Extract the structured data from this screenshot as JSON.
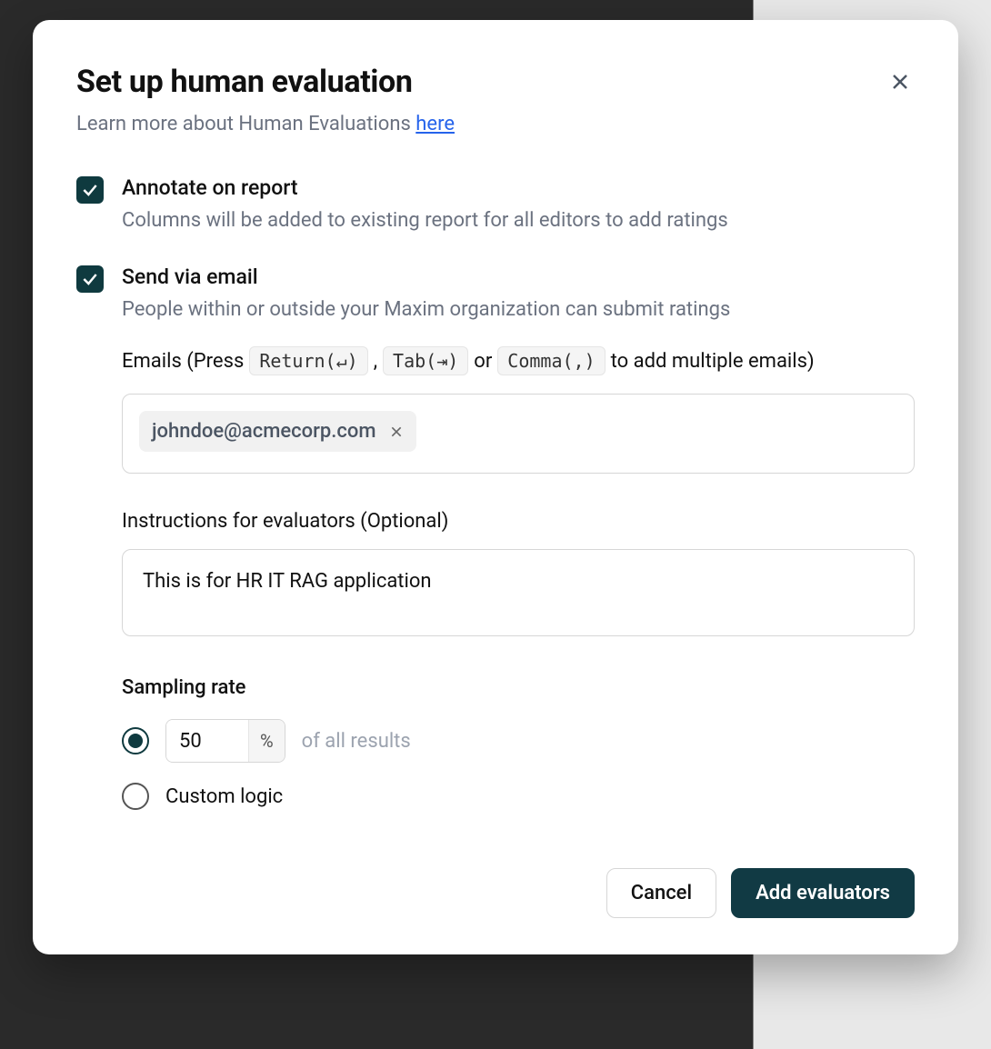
{
  "modal": {
    "title": "Set up human evaluation",
    "subtitle_prefix": "Learn more about Human Evaluations ",
    "subtitle_link": "here"
  },
  "options": {
    "annotate": {
      "checked": true,
      "title": "Annotate on report",
      "desc": "Columns will be added to existing report for all editors to add ratings"
    },
    "email": {
      "checked": true,
      "title": "Send via email",
      "desc": "People within or outside your Maxim organization can submit ratings"
    }
  },
  "emails": {
    "label_prefix": "Emails (Press",
    "kbd_return": "Return(↵)",
    "sep1": ",",
    "kbd_tab": "Tab(⇥)",
    "sep2": "or",
    "kbd_comma": "Comma(,)",
    "label_suffix": "to add multiple emails)",
    "chips": [
      "johndoe@acmecorp.com"
    ]
  },
  "instructions": {
    "label": "Instructions for evaluators (Optional)",
    "value": "This is for HR IT RAG application"
  },
  "sampling": {
    "title": "Sampling rate",
    "percent_value": "50",
    "percent_suffix": "%",
    "percent_desc": "of all results",
    "custom_label": "Custom logic",
    "selected": "percent"
  },
  "footer": {
    "cancel": "Cancel",
    "submit": "Add evaluators"
  }
}
